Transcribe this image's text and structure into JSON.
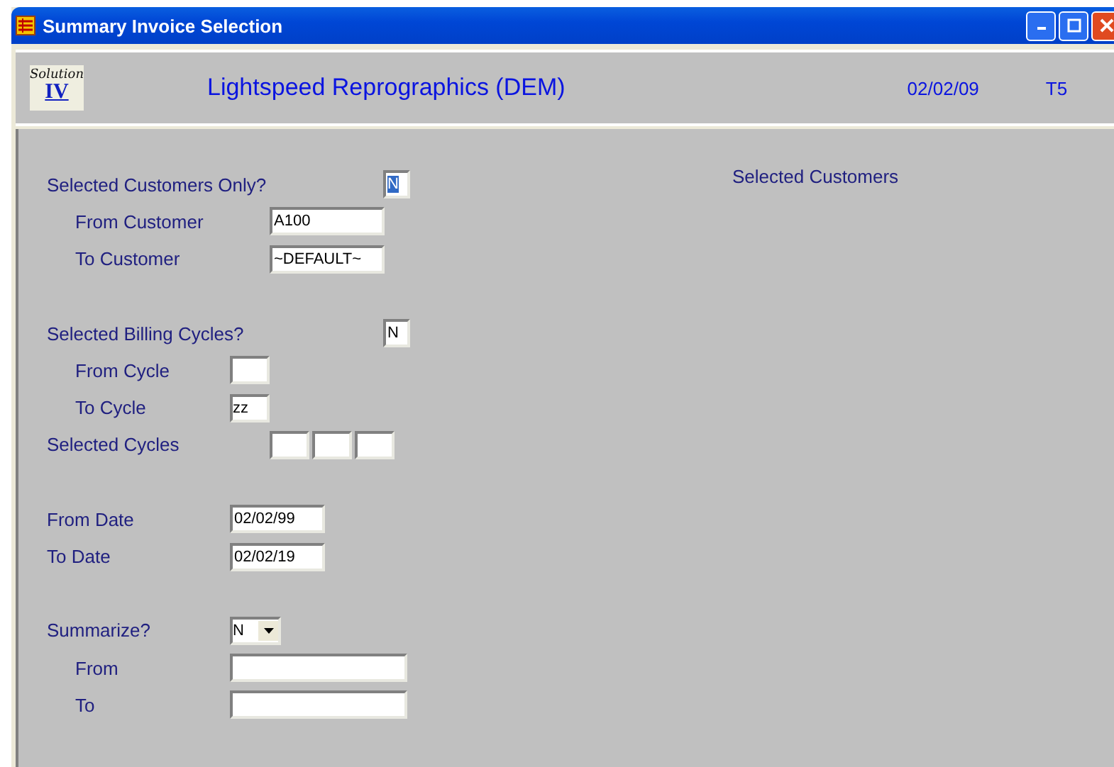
{
  "window": {
    "title": "Summary Invoice Selection"
  },
  "header": {
    "logo": {
      "script": "Solution",
      "mark": "IV"
    },
    "company": "Lightspeed Reprographics (DEM)",
    "date": "02/02/09",
    "terminal": "T5"
  },
  "sections": [
    {
      "fields": [
        {
          "label": "Selected Customers Only?",
          "kind": "yn",
          "value": "N",
          "focused": true,
          "children": [
            {
              "label": "From Customer",
              "kind": "code",
              "value": "A100"
            },
            {
              "label": "To Customer",
              "kind": "code",
              "value": "~DEFAULT~"
            }
          ]
        }
      ]
    },
    {
      "fields": [
        {
          "label": "Selected Billing Cycles?",
          "kind": "yn",
          "value": "N",
          "focused": false,
          "children": [
            {
              "label": "From Cycle",
              "kind": "short"
            },
            {
              "label": "To Cycle",
              "kind": "short",
              "value": "zz"
            }
          ]
        },
        {
          "label": "Selected Cycles",
          "kind": "multi",
          "cells": [
            {
              "selected": false
            },
            {
              "selected": false
            },
            {
              "selected": false
            }
          ]
        }
      ]
    },
    {
      "fields": [
        {
          "label": "From Date",
          "kind": "date",
          "value": "02/02/99"
        },
        {
          "label": "To Date",
          "kind": "date",
          "value": "02/02/19"
        }
      ]
    },
    {
      "fields": [
        {
          "label": "Summarize?",
          "kind": "dropdown",
          "value": "N",
          "children": [
            {
              "label": "From",
              "kind": "wide"
            },
            {
              "label": "To",
              "kind": "wide"
            }
          ]
        }
      ]
    }
  ],
  "side_label": "Selected Customers"
}
